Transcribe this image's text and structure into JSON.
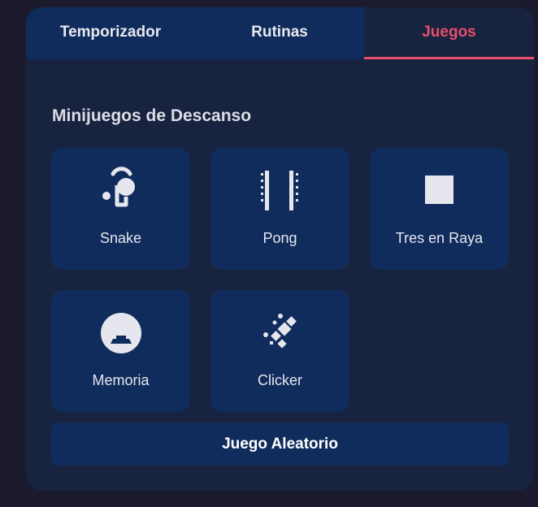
{
  "tabs": [
    {
      "label": "Temporizador",
      "active": false
    },
    {
      "label": "Rutinas",
      "active": false
    },
    {
      "label": "Juegos",
      "active": true
    }
  ],
  "section_title": "Minijuegos de Descanso",
  "games": [
    {
      "label": "Snake",
      "icon": "snake-icon"
    },
    {
      "label": "Pong",
      "icon": "pong-icon"
    },
    {
      "label": "Tres en Raya",
      "icon": "tic-tac-toe-icon"
    },
    {
      "label": "Memoria",
      "icon": "memory-icon"
    },
    {
      "label": "Clicker",
      "icon": "clicker-icon"
    }
  ],
  "random_button": "Juego Aleatorio",
  "colors": {
    "page_background": "#1b1b2d",
    "panel_background": "#182340",
    "card_background": "#0f2c5c",
    "accent": "#e94e6b",
    "text": "#e6e6ee"
  }
}
